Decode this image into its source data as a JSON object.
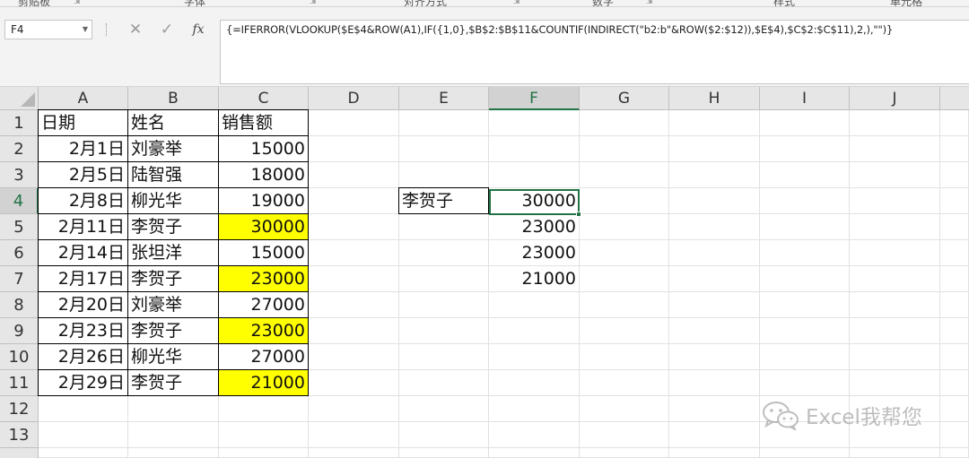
{
  "ribbon": {
    "groups": [
      "剪贴板",
      "字体",
      "对齐方式",
      "数字",
      "样式",
      "单元格"
    ]
  },
  "formula_bar": {
    "name_box": "F4",
    "cancel_icon": "✕",
    "enter_icon": "✓",
    "fx_label": "fx",
    "formula": "{=IFERROR(VLOOKUP($E$4&ROW(A1),IF({1,0},$B$2:$B$11&COUNTIF(INDIRECT(\"b2:b\"&ROW($2:$12)),$E$4),$C$2:$C$11),2,),\"\")}"
  },
  "sheet": {
    "columns": [
      "A",
      "B",
      "C",
      "D",
      "E",
      "F",
      "G",
      "H",
      "I",
      "J"
    ],
    "rows": [
      "1",
      "2",
      "3",
      "4",
      "5",
      "6",
      "7",
      "8",
      "9",
      "10",
      "11",
      "12",
      "13"
    ],
    "selected_column": "F",
    "selected_row": "4",
    "header": {
      "date": "日期",
      "name": "姓名",
      "sales": "销售额"
    },
    "records": [
      {
        "date": "2月1日",
        "name": "刘豪举",
        "sales": "15000",
        "highlight": false
      },
      {
        "date": "2月5日",
        "name": "陆智强",
        "sales": "18000",
        "highlight": false
      },
      {
        "date": "2月8日",
        "name": "柳光华",
        "sales": "19000",
        "highlight": false
      },
      {
        "date": "2月11日",
        "name": "李贺子",
        "sales": "30000",
        "highlight": true
      },
      {
        "date": "2月14日",
        "name": "张坦洋",
        "sales": "15000",
        "highlight": false
      },
      {
        "date": "2月17日",
        "name": "李贺子",
        "sales": "23000",
        "highlight": true
      },
      {
        "date": "2月20日",
        "name": "刘豪举",
        "sales": "27000",
        "highlight": false
      },
      {
        "date": "2月23日",
        "name": "李贺子",
        "sales": "23000",
        "highlight": true
      },
      {
        "date": "2月26日",
        "name": "柳光华",
        "sales": "27000",
        "highlight": false
      },
      {
        "date": "2月29日",
        "name": "李贺子",
        "sales": "21000",
        "highlight": true
      }
    ],
    "lookup_name": "李贺子",
    "results": [
      "30000",
      "23000",
      "23000",
      "21000"
    ],
    "highlight_color": "#ffff00",
    "selection_color": "#217346"
  },
  "watermark": {
    "text": "Excel我帮您",
    "icon": "wechat-icon"
  }
}
